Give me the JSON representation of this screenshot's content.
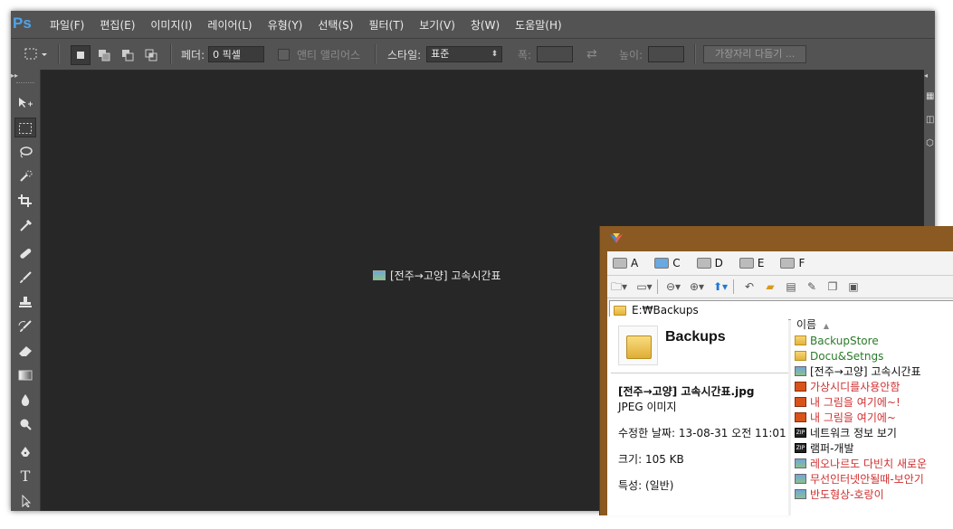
{
  "app": {
    "logo": "Ps"
  },
  "menu": [
    "파일(F)",
    "편집(E)",
    "이미지(I)",
    "레이어(L)",
    "유형(Y)",
    "선택(S)",
    "필터(T)",
    "보기(V)",
    "창(W)",
    "도움말(H)"
  ],
  "options": {
    "feather_label": "페더:",
    "feather_value": "0 픽셀",
    "antialias_label": "앤티 앨리어스",
    "style_label": "스타일:",
    "style_value": "표준",
    "width_label": "폭:",
    "height_label": "높이:",
    "refine_button": "가장자리 다듬기 ..."
  },
  "canvas": {
    "dropped_file": "[전주→고양] 고속시간표"
  },
  "explorer": {
    "drives": [
      "A",
      "C",
      "D",
      "E",
      "F"
    ],
    "address": "E:₩Backups",
    "preview": {
      "title": "Backups",
      "filename": "[전주→고양] 고속시간표.jpg",
      "filetype": "JPEG 이미지",
      "modified": "수정한 날짜: 13-08-31 오전 11:01",
      "size": "크기: 105 KB",
      "attributes": "특성: (일반)"
    },
    "column_header": "이름",
    "files": [
      {
        "name": "BackupStore",
        "icon": "folder-icon",
        "color": "#2a7a2a"
      },
      {
        "name": "Docu&Setngs",
        "icon": "folder-icon",
        "color": "#2a7a2a"
      },
      {
        "name": "[전주→고양] 고속시간표",
        "icon": "image-icon",
        "color": "#111111"
      },
      {
        "name": "가상시디를사용안함",
        "icon": "reg-icon",
        "color": "#d03030"
      },
      {
        "name": "내 그림을 여기에~!",
        "icon": "reg-icon",
        "color": "#d03030"
      },
      {
        "name": "내 그림을 여기에~",
        "icon": "reg-icon",
        "color": "#d03030"
      },
      {
        "name": "네트워크 정보 보기",
        "icon": "zip-icon",
        "color": "#111111"
      },
      {
        "name": "램퍼-개발",
        "icon": "zip-icon",
        "color": "#111111"
      },
      {
        "name": "레오나르도 다빈치 새로운",
        "icon": "image-icon",
        "color": "#d03030"
      },
      {
        "name": "무선인터넷안될때-보안기",
        "icon": "image-icon",
        "color": "#d03030"
      },
      {
        "name": "반도형상-호랑이",
        "icon": "image-icon",
        "color": "#d03030"
      }
    ]
  }
}
